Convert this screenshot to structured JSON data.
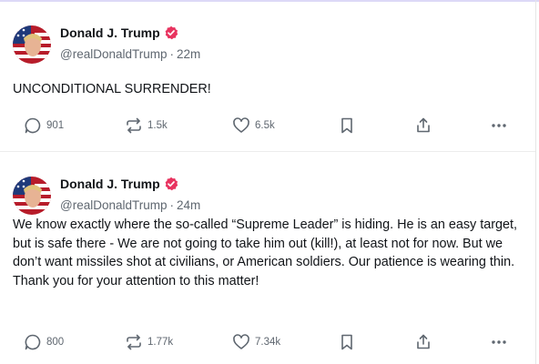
{
  "posts": [
    {
      "author_name": "Donald J. Trump",
      "handle": "@realDonaldTrump",
      "separator": "·",
      "time": "22m",
      "text": "UNCONDITIONAL SURRENDER!",
      "replies": "901",
      "reblogs": "1.5k",
      "favourites": "6.5k"
    },
    {
      "author_name": "Donald J. Trump",
      "handle": "@realDonaldTrump",
      "separator": "·",
      "time": "24m",
      "text": "We know exactly where the so-called “Supreme Leader” is hiding. He is an easy target, but is safe there - We are not going to take him out (kill!), at least not for now. But we don’t want missiles shot at civilians, or American soldiers. Our patience is wearing thin. Thank you for your attention to this matter!",
      "replies": "800",
      "reblogs": "1.77k",
      "favourites": "7.34k"
    }
  ],
  "icons": {
    "reply": "speech-bubble",
    "reblog": "repeat-arrows",
    "favourite": "heart",
    "bookmark": "bookmark",
    "share": "share-upload",
    "more": "three-dots",
    "verified": "verified-badge"
  },
  "colors": {
    "verified": "#e8335f",
    "text": "#111418",
    "muted": "#5f6770",
    "accent_top": "#ddd9f7"
  }
}
